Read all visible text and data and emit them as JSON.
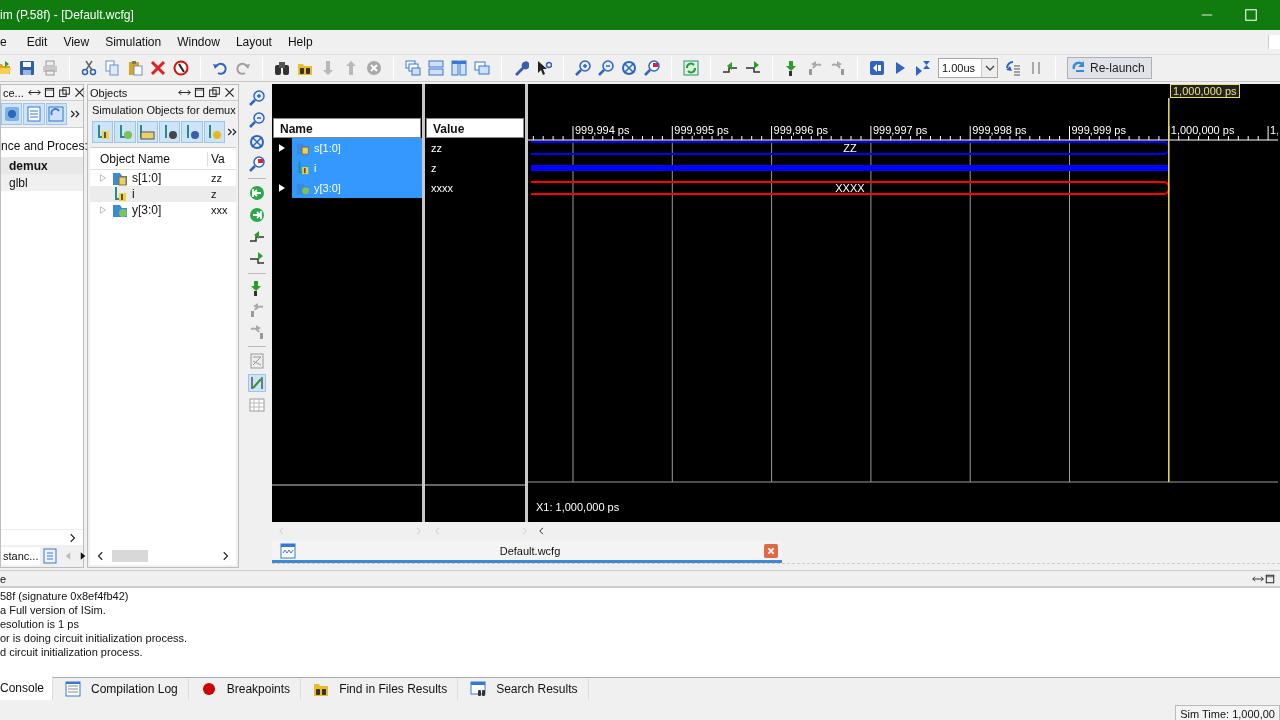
{
  "window": {
    "title": "im (P.58f) - [Default.wcfg]"
  },
  "menu": [
    {
      "label": "e"
    },
    {
      "label": "Edit"
    },
    {
      "label": "View"
    },
    {
      "label": "Simulation"
    },
    {
      "label": "Window"
    },
    {
      "label": "Layout"
    },
    {
      "label": "Help"
    }
  ],
  "toolbar": {
    "run_time": "1.00us",
    "relaunch": "Re-launch"
  },
  "instances_panel": {
    "title": "ce...",
    "tree_header": "nce and Proces:",
    "items": [
      {
        "label": "demux",
        "selected": true
      },
      {
        "label": "glbl",
        "selected": false
      }
    ],
    "tab": "stanc..."
  },
  "objects_panel": {
    "title": "Objects",
    "subtitle": "Simulation Objects for demux",
    "columns": [
      "Object Name",
      "Va"
    ],
    "rows": [
      {
        "name": "s[1:0]",
        "value": "zz",
        "expandable": true,
        "selected": false
      },
      {
        "name": "i",
        "value": "z",
        "expandable": false,
        "selected": true
      },
      {
        "name": "y[3:0]",
        "value": "xxx",
        "expandable": true,
        "selected": false
      }
    ]
  },
  "wave": {
    "columns": [
      "Name",
      "Value"
    ],
    "signals": [
      {
        "name": "s[1:0]",
        "value": "zz",
        "kind": "bus",
        "color": "#0000ff",
        "wave_label": "ZZ",
        "selected": true,
        "expandable": true
      },
      {
        "name": "i",
        "value": "z",
        "kind": "bit",
        "color": "#0000ff",
        "selected": true,
        "expandable": false
      },
      {
        "name": "y[3:0]",
        "value": "xxxx",
        "kind": "bus",
        "color": "#ff0000",
        "wave_label": "XXXX",
        "selected": true,
        "expandable": true
      }
    ],
    "ticks": [
      "999,994 ps",
      "999,995 ps",
      "999,996 ps",
      "999,997 ps",
      "999,998 ps",
      "999,999 ps",
      "1,000,000 ps",
      "1,"
    ],
    "cursor_label": "1,000,000 ps",
    "cursor_readout": "X1: 1,000,000 ps"
  },
  "editor_tab": {
    "label": "Default.wcfg"
  },
  "console": {
    "title": "e",
    "lines": [
      "58f (signature 0x8ef4fb42)",
      "a Full version of ISim.",
      "esolution is 1 ps",
      "or is doing circuit initialization process.",
      "d circuit initialization process."
    ],
    "tabs": [
      {
        "label": "Console",
        "selected": true
      },
      {
        "label": "Compilation Log",
        "kind": "log",
        "selected": false
      },
      {
        "label": "Breakpoints",
        "kind": "breakpoints",
        "selected": false
      },
      {
        "label": "Find in Files Results",
        "kind": "find",
        "selected": false
      },
      {
        "label": "Search Results",
        "kind": "search",
        "selected": false
      }
    ]
  },
  "status_bar": {
    "sim_time": "Sim Time: 1,000,00"
  }
}
